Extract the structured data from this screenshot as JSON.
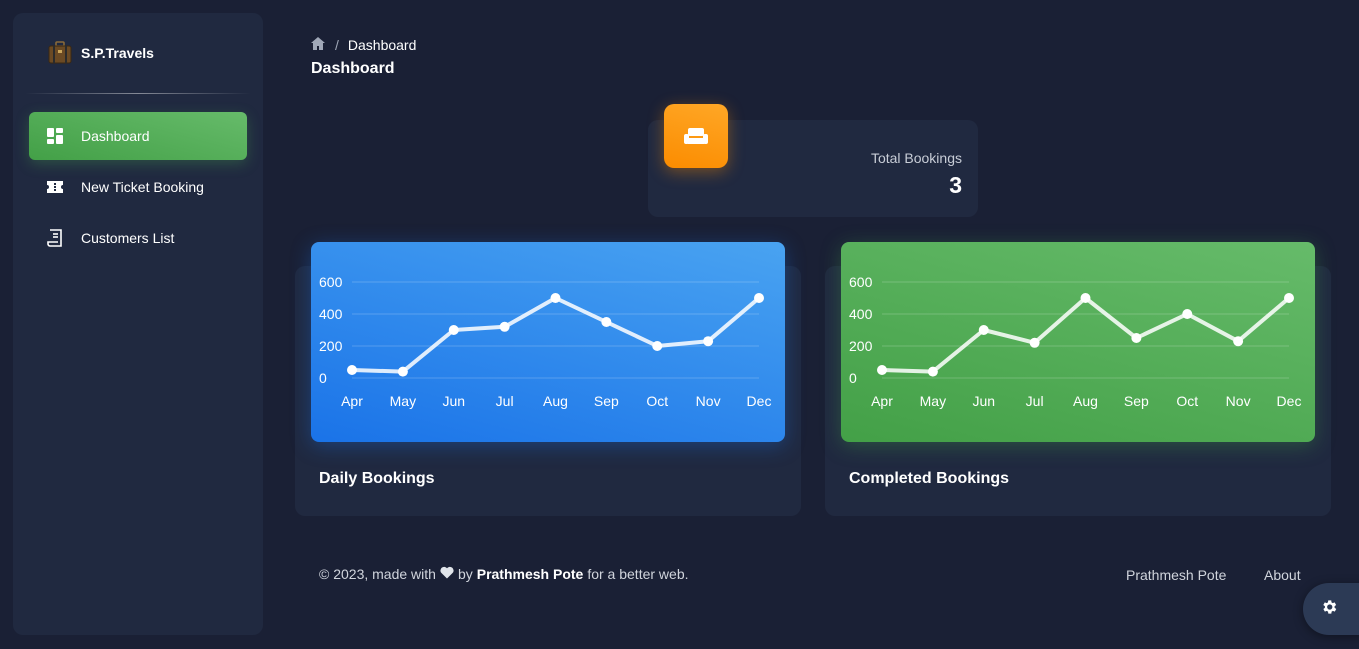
{
  "brand": {
    "name": "S.P.Travels"
  },
  "sidebar": {
    "items": [
      {
        "label": "Dashboard",
        "icon": "dashboard-icon",
        "active": true
      },
      {
        "label": "New Ticket Booking",
        "icon": "ticket-icon",
        "active": false
      },
      {
        "label": "Customers List",
        "icon": "receipt-icon",
        "active": false
      }
    ]
  },
  "breadcrumb": {
    "current": "Dashboard"
  },
  "page": {
    "title": "Dashboard"
  },
  "stat": {
    "label": "Total Bookings",
    "value": "3",
    "icon": "weekend-icon",
    "accent": "#fb8c00"
  },
  "chart_data": [
    {
      "type": "line",
      "title": "Daily Bookings",
      "categories": [
        "Apr",
        "May",
        "Jun",
        "Jul",
        "Aug",
        "Sep",
        "Oct",
        "Nov",
        "Dec"
      ],
      "series": [
        {
          "values": [
            50,
            40,
            300,
            320,
            500,
            350,
            200,
            230,
            500
          ]
        }
      ],
      "yticks": [
        0,
        200,
        400,
        600
      ],
      "ylim": [
        0,
        600
      ],
      "grid": true,
      "color": "#1a73e8"
    },
    {
      "type": "line",
      "title": "Completed Bookings",
      "categories": [
        "Apr",
        "May",
        "Jun",
        "Jul",
        "Aug",
        "Sep",
        "Oct",
        "Nov",
        "Dec"
      ],
      "series": [
        {
          "values": [
            50,
            40,
            300,
            220,
            500,
            250,
            400,
            230,
            500
          ]
        }
      ],
      "yticks": [
        0,
        200,
        400,
        600
      ],
      "ylim": [
        0,
        600
      ],
      "grid": true,
      "color": "#43a047"
    }
  ],
  "footer": {
    "prefix": "© 2023, made with",
    "by": "by",
    "author": "Prathmesh Pote",
    "suffix": "for a better web.",
    "links": [
      "Prathmesh Pote",
      "About"
    ]
  }
}
